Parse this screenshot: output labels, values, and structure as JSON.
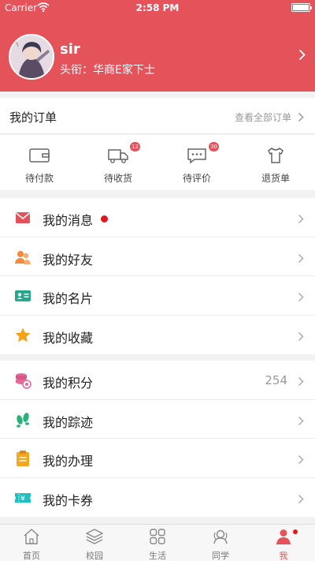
{
  "status_bar": {
    "carrier": "Carrier",
    "time": "2:58 PM",
    "wifi_icon": "wifi-icon",
    "battery_icon": "battery-icon"
  },
  "profile": {
    "name": "sir",
    "rank": "头衔：华商E家下士",
    "avatar_icon": "avatar-image"
  },
  "orders": {
    "title": "我的订单",
    "view_all": "查看全部订单",
    "items": [
      {
        "label": "待付款",
        "icon": "wallet-icon",
        "badge": ""
      },
      {
        "label": "待收货",
        "icon": "truck-icon",
        "badge": "12"
      },
      {
        "label": "待评价",
        "icon": "comment-icon",
        "badge": "30"
      },
      {
        "label": "退货单",
        "icon": "return-shirt-icon",
        "badge": ""
      }
    ]
  },
  "menu_group1": [
    {
      "label": "我的消息",
      "icon": "mail-icon",
      "value": "",
      "dot": true
    },
    {
      "label": "我的好友",
      "icon": "friends-icon",
      "value": "",
      "dot": false
    },
    {
      "label": "我的名片",
      "icon": "business-card-icon",
      "value": "",
      "dot": false
    },
    {
      "label": "我的收藏",
      "icon": "star-icon",
      "value": "",
      "dot": false
    }
  ],
  "menu_group2": [
    {
      "label": "我的积分",
      "icon": "points-coins-icon",
      "value": "254",
      "dot": false
    },
    {
      "label": "我的踪迹",
      "icon": "footprints-icon",
      "value": "",
      "dot": false
    },
    {
      "label": "我的办理",
      "icon": "clipboard-icon",
      "value": "",
      "dot": false
    },
    {
      "label": "我的卡券",
      "icon": "coupon-icon",
      "value": "",
      "dot": false
    }
  ],
  "tabs": [
    {
      "label": "首页",
      "icon": "home-icon",
      "active": false
    },
    {
      "label": "校园",
      "icon": "layers-icon",
      "active": false
    },
    {
      "label": "生活",
      "icon": "grid-icon",
      "active": false
    },
    {
      "label": "同学",
      "icon": "classmates-icon",
      "active": false
    },
    {
      "label": "我",
      "icon": "person-icon",
      "active": true
    }
  ],
  "colors": {
    "accent": "#e4525a",
    "dot": "#e4151f",
    "page_bg": "#f2f2f2"
  }
}
